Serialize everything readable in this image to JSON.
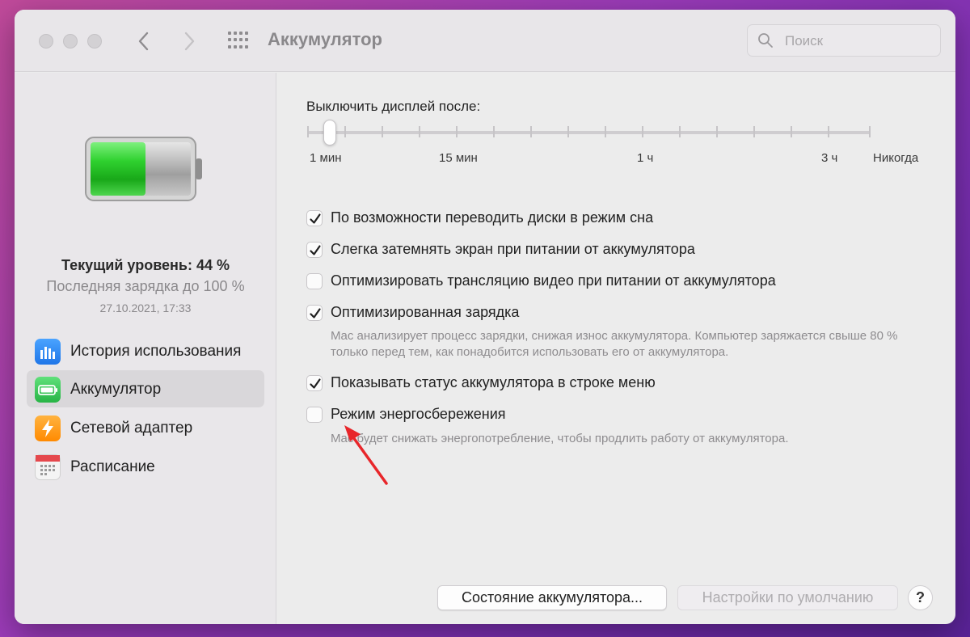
{
  "window": {
    "title": "Аккумулятор",
    "nav_back": "‹",
    "nav_forward": "›",
    "search_placeholder": "Поиск"
  },
  "sidebar": {
    "current_level": "Текущий уровень: 44 %",
    "charge_level_percent": 44,
    "last_charge": "Последняя зарядка до 100 %",
    "last_charge_date": "27.10.2021, 17:33",
    "items": [
      {
        "label": "История использования",
        "icon": "usage-history-icon",
        "color": "#2d8cf0"
      },
      {
        "label": "Аккумулятор",
        "icon": "battery-icon",
        "color": "#34c759",
        "selected": true
      },
      {
        "label": "Сетевой адаптер",
        "icon": "power-adapter-icon",
        "color": "#ff9f0a"
      },
      {
        "label": "Расписание",
        "icon": "calendar-icon",
        "color": "#e5e5e5"
      }
    ]
  },
  "main": {
    "slider": {
      "label": "Выключить дисплей после:",
      "selected": "1 мин",
      "tick_labels": [
        "1 мин",
        "15 мин",
        "1 ч",
        "3 ч",
        "Никогда"
      ]
    },
    "options": [
      {
        "label": "По возможности переводить диски в режим сна",
        "checked": true
      },
      {
        "label": "Слегка затемнять экран при питании от аккумулятора",
        "checked": true
      },
      {
        "label": "Оптимизировать трансляцию видео при питании от аккумулятора",
        "checked": false
      },
      {
        "label": "Оптимизированная зарядка",
        "checked": true,
        "description": "Mac анализирует процесс зарядки, снижая износ аккумулятора. Компьютер заряжается свыше 80 % только перед тем, как понадобится использовать его от аккумулятора."
      },
      {
        "label": "Показывать статус аккумулятора в строке меню",
        "checked": true
      },
      {
        "label": "Режим энергосбережения",
        "checked": false,
        "description": "Mac будет снижать энергопотребление, чтобы продлить работу от аккумулятора."
      }
    ],
    "buttons": {
      "battery_status": "Состояние аккумулятора...",
      "defaults": "Настройки по умолчанию",
      "help": "?"
    }
  },
  "colors": {
    "battery_green": "#2fd12f",
    "annotation_arrow": "#e8262a"
  }
}
